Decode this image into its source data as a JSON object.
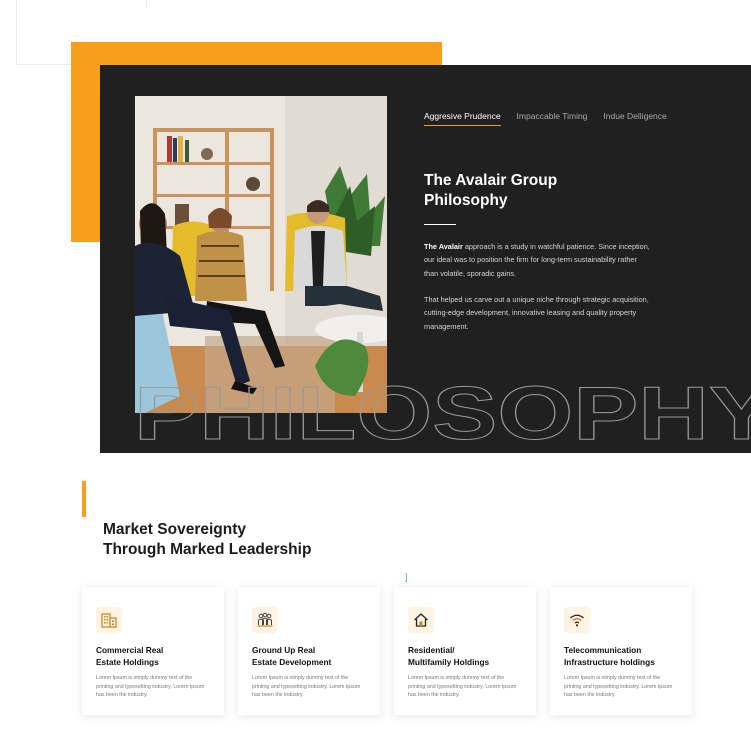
{
  "hero": {
    "tabs": [
      {
        "label": "Aggresive Prudence",
        "active": true
      },
      {
        "label": "Impaccable Timing",
        "active": false
      },
      {
        "label": "Indue Delligence",
        "active": false
      }
    ],
    "title": "The  Avalair Group\nPhilosophy",
    "paragraph1_lead": "The Avalair",
    "paragraph1_rest": " approach is a study in watchful patience. Since inception, our ideal was to position the firm for long-term sustainability rather than volatile, sporadic gains.",
    "paragraph2": "That helped us carve out a unique niche through strategic acquisition, cutting-edge development, innovative leasing and quality property management.",
    "background_word": "PHILOSOPHY"
  },
  "section": {
    "title": "Market Sovereignty\nThrough Marked Leadership",
    "cursor_mark": "]"
  },
  "cards": [
    {
      "icon": "building-icon",
      "title": "Commercial Real\nEstate Holdings",
      "text": "Lorem Ipsum is simply dummy text of the printing and typesetting industry. Lorem Ipsum has been the industry."
    },
    {
      "icon": "people-group-icon",
      "title": "Ground Up Real\nEstate Development",
      "text": "Lorem Ipsum is simply dummy text of the printing and typesetting industry. Lorem Ipsum has been the industry."
    },
    {
      "icon": "house-icon",
      "title": "Residential/\nMultifamily Holdings",
      "text": "Lorem Ipsum is simply dummy text of the printing and typesetting industry. Lorem Ipsum has been the industry."
    },
    {
      "icon": "wifi-icon",
      "title": "Telecommunication\nInfrastructure holdings",
      "text": "Lorem Ipsum is simply dummy text of the printing and typesetting industry. Lorem Ipsum has been the industry."
    }
  ],
  "colors": {
    "accent": "#f99d1c",
    "dark_panel": "#202020",
    "text_dark": "#1b1b1b"
  }
}
